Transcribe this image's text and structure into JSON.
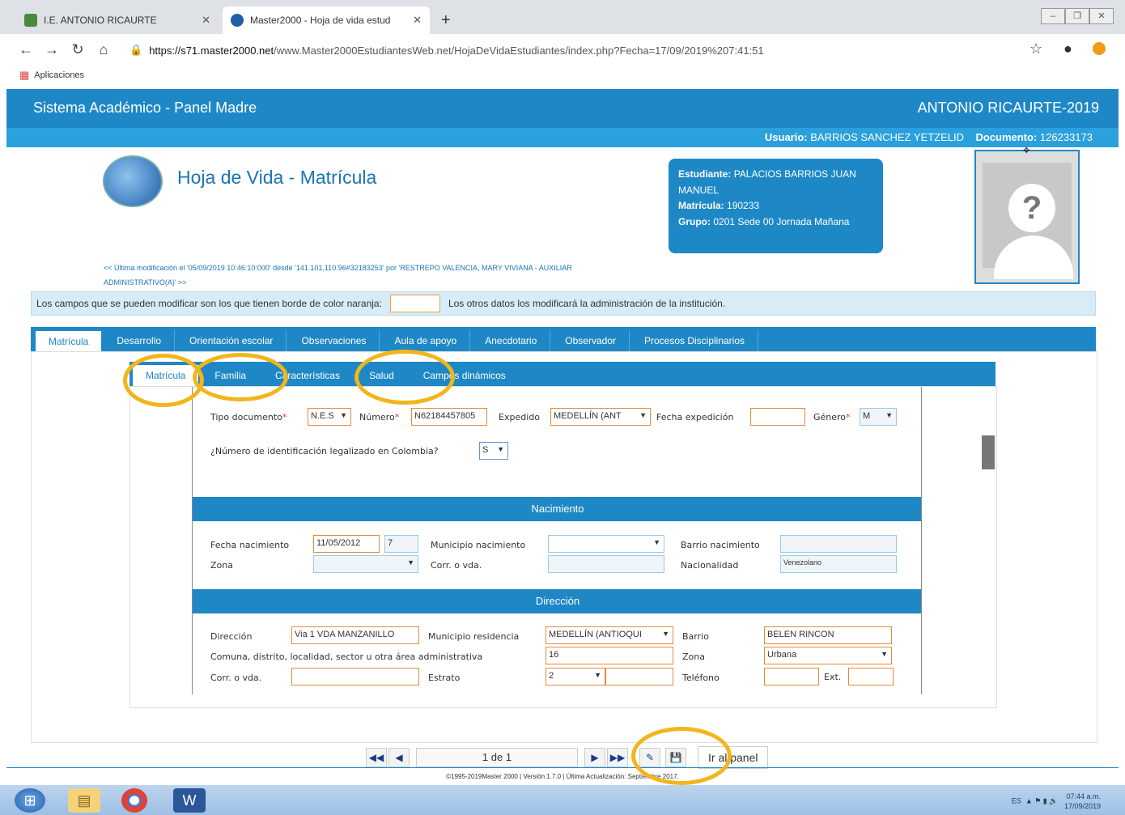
{
  "browser": {
    "tabs": [
      {
        "title": "I.E. ANTONIO RICAURTE"
      },
      {
        "title": "Master2000 - Hoja de vida estud"
      }
    ],
    "url_host": "https://s71.master2000.net",
    "url_path": "/www.Master2000EstudiantesWeb.net/HojaDeVidaEstudiantes/index.php?Fecha=17/09/2019%207:41:51",
    "bookmarks_label": "Aplicaciones"
  },
  "app": {
    "title": "Sistema Académico - Panel Madre",
    "institution": "ANTONIO RICAURTE-2019",
    "user_label": "Usuario:",
    "user_name": "BARRIOS SANCHEZ YETZELID",
    "doc_label": "Documento:",
    "doc_value": "126233173"
  },
  "page": {
    "title": "Hoja de Vida - Matrícula",
    "last_modified": "<< Última modificación el '05/09/2019 10:46:10:000' desde '141.101.110.96#32183253' por 'RESTREPO VALENCIA, MARY VIVIANA - AUXILIAR ADMINISTRATIVO(A)' >>",
    "info_left": "Los campos que se pueden modificar son los que tienen borde de color naranja:",
    "info_right": "Los otros datos los modificará la administración de la institución."
  },
  "student": {
    "name_label": "Estudiante:",
    "name": "PALACIOS BARRIOS JUAN MANUEL",
    "matricula_label": "Matrícula:",
    "matricula": "190233",
    "grupo_label": "Grupo:",
    "grupo": "0201 Sede 00 Jornada Mañana"
  },
  "main_tabs": [
    "Matrícula",
    "Desarrollo",
    "Orientación escolar",
    "Observaciones",
    "Aula de apoyo",
    "Anecdotario",
    "Observador",
    "Procesos Disciplinarios"
  ],
  "sub_tabs": [
    "Matrícula",
    "Familia",
    "Características",
    "Salud",
    "Campos dinámicos"
  ],
  "form": {
    "tipo_doc_label": "Tipo documento",
    "tipo_doc": "N.E.S",
    "numero_label": "Número",
    "numero": "N62184457805",
    "expedido_label": "Expedido",
    "expedido": "MEDELLÍN (ANT",
    "fecha_exp_label": "Fecha expedición",
    "fecha_exp": "",
    "genero_label": "Género",
    "genero": "M",
    "legalizado_label": "¿Número de identificación legalizado en Colombia?",
    "legalizado": "S",
    "nacimiento_title": "Nacimiento",
    "fecha_nac_label": "Fecha nacimiento",
    "fecha_nac": "11/05/2012",
    "edad": "7",
    "mun_nac_label": "Municipio nacimiento",
    "mun_nac": "",
    "barrio_nac_label": "Barrio nacimiento",
    "barrio_nac": "",
    "zona_label": "Zona",
    "zona_nac": "",
    "corr_label": "Corr. o vda.",
    "corr_nac": "",
    "nacionalidad_label": "Nacionalidad",
    "nacionalidad": "Venezolano",
    "direccion_title": "Dirección",
    "direccion_label": "Dirección",
    "direccion": "Via 1 VDA MANZANILLO",
    "mun_res_label": "Municipio residencia",
    "mun_res": "MEDELLÍN (ANTIOQUI",
    "barrio_label": "Barrio",
    "barrio": "BELEN RINCON",
    "comuna_label": "Comuna, distrito, localidad, sector u otra área administrativa",
    "comuna": "16",
    "zona_res_label": "Zona",
    "zona_res": "Urbana",
    "corr_res_label": "Corr. o vda.",
    "corr_res": "",
    "estrato_label": "Estrato",
    "estrato": "2",
    "telefono_label": "Teléfono",
    "telefono": "",
    "ext_label": "Ext.",
    "ext": ""
  },
  "pager": {
    "page_info": "1 de 1",
    "panel_label": "Ir al panel"
  },
  "footer": {
    "copyright": "©1995-2019Master 2000 | Versión 1.7.0 | Última Actualización: Septiembre 2017."
  },
  "taskbar": {
    "lang": "ES",
    "time": "07:44 a.m.",
    "date": "17/09/2019"
  },
  "colors": {
    "primary": "#1e88c7",
    "highlight_ring": "#f2b51c",
    "editable_border": "#e8883a"
  }
}
